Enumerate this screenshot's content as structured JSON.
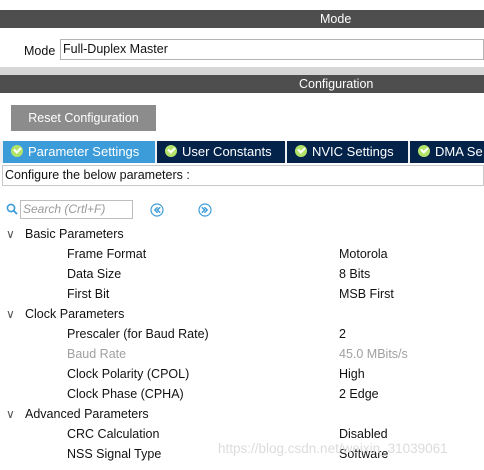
{
  "headers": {
    "mode": "Mode",
    "configuration": "Configuration"
  },
  "mode": {
    "label": "Mode",
    "value": "Full-Duplex Master"
  },
  "toolbar": {
    "reset_label": "Reset Configuration"
  },
  "tabs": [
    {
      "label": "Parameter Settings",
      "active": true
    },
    {
      "label": "User Constants",
      "active": false
    },
    {
      "label": "NVIC Settings",
      "active": false
    },
    {
      "label": "DMA Se",
      "active": false
    }
  ],
  "configure_text": "Configure the below parameters :",
  "search": {
    "placeholder": "Search (Crtl+F)"
  },
  "groups": [
    {
      "label": "Basic Parameters",
      "params": [
        {
          "name": "Frame Format",
          "value": "Motorola",
          "disabled": false
        },
        {
          "name": "Data Size",
          "value": "8 Bits",
          "disabled": false
        },
        {
          "name": "First Bit",
          "value": "MSB First",
          "disabled": false
        }
      ]
    },
    {
      "label": "Clock Parameters",
      "params": [
        {
          "name": "Prescaler (for Baud Rate)",
          "value": "2",
          "disabled": false
        },
        {
          "name": "Baud Rate",
          "value": "45.0 MBits/s",
          "disabled": true
        },
        {
          "name": "Clock Polarity (CPOL)",
          "value": "High",
          "disabled": false
        },
        {
          "name": "Clock Phase (CPHA)",
          "value": "2 Edge",
          "disabled": false
        }
      ]
    },
    {
      "label": "Advanced Parameters",
      "params": [
        {
          "name": "CRC Calculation",
          "value": "Disabled",
          "disabled": false
        },
        {
          "name": "NSS Signal Type",
          "value": "Software",
          "disabled": false
        }
      ]
    }
  ],
  "watermark": "https://blog.csdn.net/weixin_31039061",
  "colors": {
    "header_bg": "#4e4e4e",
    "tab_active": "#3c9cd9",
    "tab_inactive": "#03234b",
    "check": "#b3e46a",
    "button_bg": "#8c8c8c"
  }
}
